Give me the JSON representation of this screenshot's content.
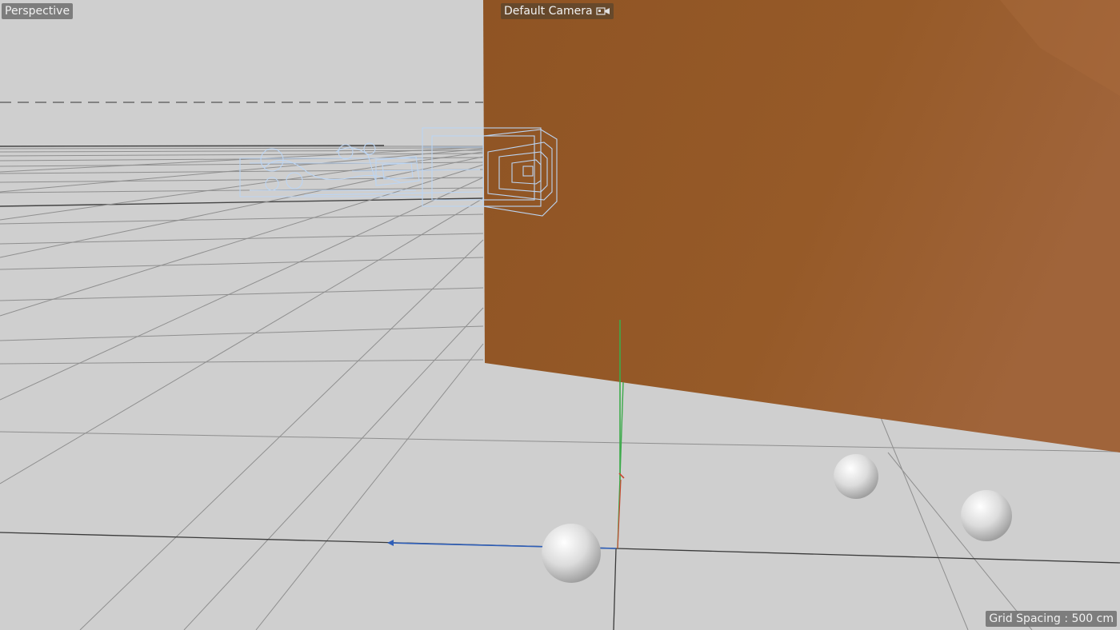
{
  "viewport": {
    "view_name": "Perspective",
    "camera_name": "Default Camera",
    "grid_spacing": "Grid Spacing : 500 cm",
    "camera_icon": "camera-icon"
  },
  "colors": {
    "background": "#cfcfcf",
    "grid_line": "#9a9a9a",
    "wall": "#955a28",
    "wall_dark": "#7d4818",
    "wireframe": "#b8d3f2",
    "axis_y": "#3caa4a",
    "axis_x": "#c84a32",
    "axis_z": "#2f5fb8",
    "sphere": "#e2e2e2"
  },
  "scene": {
    "object_count_spheres": 3
  }
}
